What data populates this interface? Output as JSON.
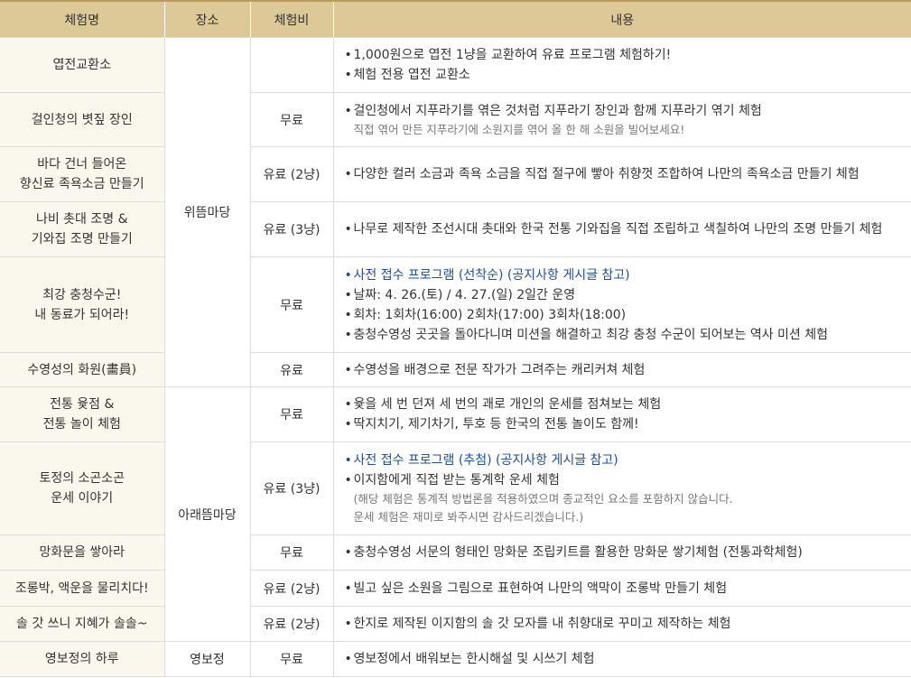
{
  "headers": {
    "name": "체험명",
    "place": "장소",
    "fee": "체험비",
    "desc": "내용"
  },
  "places": {
    "upper": "위뜸마당",
    "lower": "아래뜸마당",
    "yeongbo": "영보정"
  },
  "rows": [
    {
      "name": [
        "엽전교환소"
      ],
      "fee": "",
      "items": [
        {
          "t": "1,000원으로 엽전 1냥을 교환하여 유료 프로그램 체험하기!"
        },
        {
          "t": "체험 전용 엽전 교환소"
        }
      ],
      "notes": []
    },
    {
      "name": [
        "걸인청의 볏짚 장인"
      ],
      "fee": "무료",
      "items": [
        {
          "t": "걸인청에서 지푸라기를 엮은 것처럼 지푸라기 장인과 함께 지푸라기 엮기 체험"
        }
      ],
      "notes": [
        "직접 엮어 만든 지푸라기에 소원지를 엮어 올 한 해 소원을 빌어보세요!"
      ]
    },
    {
      "name": [
        "바다 건너 들어온",
        "향신료 족욕소금 만들기"
      ],
      "fee": "유료 (2냥)",
      "items": [
        {
          "t": "다양한 컬러 소금과 족욕 소금을 직접 절구에 빻아 취향껏 조합하여 나만의 족욕소금 만들기 체험"
        }
      ],
      "notes": []
    },
    {
      "name": [
        "나비 촛대 조명 &",
        "기와집 조명 만들기"
      ],
      "fee": "유료 (3냥)",
      "items": [
        {
          "t": "나무로 제작한 조선시대 촛대와 한국 전통 기와집을 직접 조립하고 색칠하여 나만의 조명 만들기 체험"
        }
      ],
      "notes": []
    },
    {
      "name": [
        "최강 충청수군!",
        "내 동료가 되어라!"
      ],
      "fee": "무료",
      "items": [
        {
          "t": "사전 접수 프로그램 (선착순) (공지사항 게시글 참고)",
          "hl": true
        },
        {
          "t": "날짜: 4. 26.(토) / 4. 27.(일) 2일간 운영"
        },
        {
          "t": "회차: 1회차(16:00) 2회차(17:00) 3회차(18:00)"
        },
        {
          "t": "충청수영성 곳곳을 돌아다니며 미션을 해결하고 최강 충청 수군이 되어보는 역사 미션 체험"
        }
      ],
      "notes": []
    },
    {
      "name": [
        "수영성의 화원(畵員)"
      ],
      "fee": "유료",
      "items": [
        {
          "t": "수영성을 배경으로 전문 작가가 그려주는 캐리커쳐 체험"
        }
      ],
      "notes": []
    },
    {
      "name": [
        "전통 윷점 &",
        "전통 놀이 체험"
      ],
      "fee": "무료",
      "items": [
        {
          "t": "윷을 세 번 던져 세 번의 괘로 개인의 운세를 점쳐보는 체험"
        },
        {
          "t": "딱지치기, 제기차기, 투호 등 한국의 전통 놀이도 함께!"
        }
      ],
      "notes": []
    },
    {
      "name": [
        "토정의 소곤소곤",
        "운세 이야기"
      ],
      "fee": "유료 (3냥)",
      "items": [
        {
          "t": "사전 접수 프로그램 (추첨) (공지사항 게시글 참고)",
          "hl": true
        },
        {
          "t": "이지함에게 직접 받는 통계학 운세 체험"
        }
      ],
      "notes": [
        "(해당 체험은 통계적 방법론을 적용하였으며 종교적인 요소를 포함하지 않습니다.",
        "운세 체험은 재미로 봐주시면 감사드리겠습니다.)"
      ]
    },
    {
      "name": [
        "망화문을 쌓아라"
      ],
      "fee": "무료",
      "items": [
        {
          "t": "충청수영성 서문의 형태인 망화문 조립키트를 활용한 망화문 쌓기체험 (전통과학체험)"
        }
      ],
      "notes": []
    },
    {
      "name": [
        "조롱박, 액운을 물리치다!"
      ],
      "fee": "유료 (2냥)",
      "items": [
        {
          "t": "빌고 싶은 소원을 그림으로 표현하여 나만의 액막이 조롱박 만들기 체험"
        }
      ],
      "notes": []
    },
    {
      "name": [
        "솔 갓 쓰니 지혜가 솔솔~"
      ],
      "fee": "유료 (2냥)",
      "items": [
        {
          "t": "한지로 제작된 이지함의 솔 갓 모자를 내 취향대로 꾸미고 제작하는 체험"
        }
      ],
      "notes": []
    },
    {
      "name": [
        "영보정의 하루"
      ],
      "fee": "무료",
      "items": [
        {
          "t": "영보정에서 배워보는 한시해설 및 시쓰기 체험"
        }
      ],
      "notes": []
    }
  ]
}
